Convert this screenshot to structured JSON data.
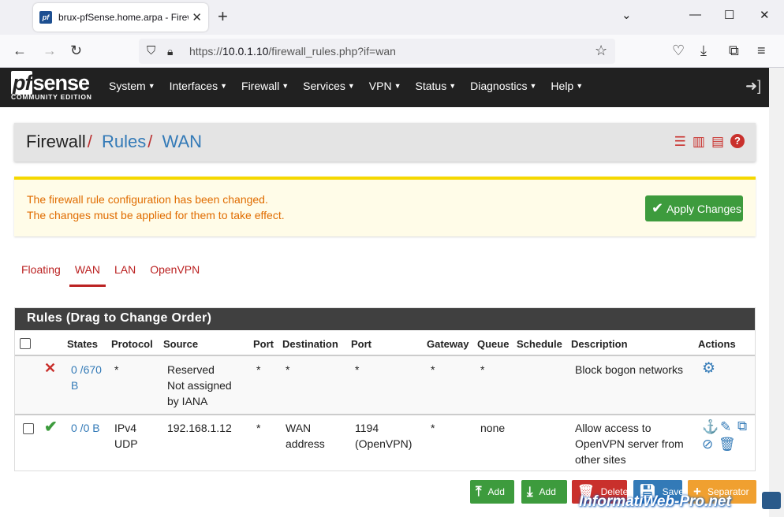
{
  "browser": {
    "tab_title": "brux-pfSense.home.arpa - Firewall: Rules: WAN",
    "url_prefix": "https://",
    "url_host": "10.0.1.10",
    "url_path": "/firewall_rules.php?if=wan"
  },
  "header": {
    "logo_main": "sense",
    "logo_pf": "pf",
    "logo_sub": "COMMUNITY EDITION",
    "menu": [
      "System",
      "Interfaces",
      "Firewall",
      "Services",
      "VPN",
      "Status",
      "Diagnostics",
      "Help"
    ]
  },
  "breadcrumb": {
    "part1": "Firewall",
    "part2": "Rules",
    "part3": "WAN",
    "sep": "/"
  },
  "alert": {
    "line1": "The firewall rule configuration has been changed.",
    "line2": "The changes must be applied for them to take effect.",
    "button": "Apply Changes"
  },
  "tabs": [
    "Floating",
    "WAN",
    "LAN",
    "OpenVPN"
  ],
  "panel": {
    "title": "Rules (Drag to Change Order)",
    "columns": [
      "States",
      "Protocol",
      "Source",
      "Port",
      "Destination",
      "Port",
      "Gateway",
      "Queue",
      "Schedule",
      "Description",
      "Actions"
    ]
  },
  "rules": [
    {
      "states_a": "0 /670",
      "states_b": "B",
      "protocol_a": "*",
      "protocol_b": "",
      "source_a": "Reserved",
      "source_b": "Not assigned",
      "source_c": "by IANA",
      "port": "*",
      "destination_a": "*",
      "destination_b": "",
      "dport_a": "*",
      "dport_b": "",
      "gateway": "*",
      "queue": "*",
      "schedule": "",
      "desc_a": "Block bogon networks",
      "desc_b": "",
      "desc_c": ""
    },
    {
      "states_a": "0 /0 B",
      "states_b": "",
      "protocol_a": "IPv4",
      "protocol_b": "UDP",
      "source_a": "192.168.1.12",
      "source_b": "",
      "source_c": "",
      "port": "*",
      "destination_a": "WAN",
      "destination_b": "address",
      "dport_a": "1194",
      "dport_b": "(OpenVPN)",
      "gateway": "*",
      "queue": "none",
      "schedule": "",
      "desc_a": "Allow access to",
      "desc_b": "OpenVPN server from",
      "desc_c": "other sites"
    }
  ],
  "buttons": {
    "add_top": "Add",
    "add_bottom": "Add",
    "delete": "Delete",
    "save": "Save",
    "separator": "Separator"
  },
  "watermark": "InformatiWeb-Pro.net",
  "colors": {
    "header_bg": "#212121",
    "accent_red": "#c9302c",
    "link_blue": "#337ab7",
    "success": "#3d9b3d",
    "alert_text": "#e06c00"
  }
}
